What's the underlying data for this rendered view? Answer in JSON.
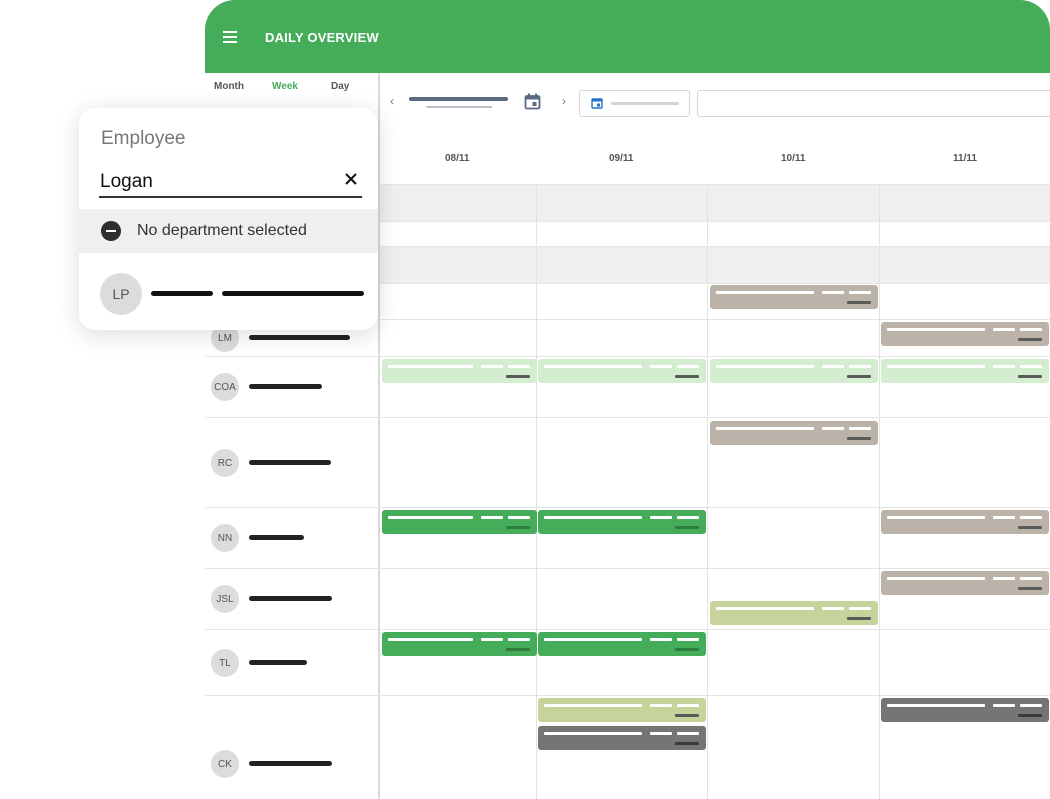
{
  "header": {
    "title": "DAILY OVERVIEW",
    "menu_icon": "menu-icon"
  },
  "views": [
    "Month",
    "Week",
    "Day"
  ],
  "active_view": "Week",
  "days": [
    "08/11",
    "09/11",
    "10/11",
    "11/11"
  ],
  "employees": [
    {
      "initials": "LM"
    },
    {
      "initials": "COA"
    },
    {
      "initials": "RC"
    },
    {
      "initials": "NN"
    },
    {
      "initials": "JSL"
    },
    {
      "initials": "TL"
    },
    {
      "initials": "CK"
    }
  ],
  "panel": {
    "label": "Employee",
    "search_value": "Logan",
    "department_text": "No department selected",
    "result_initials": "LP"
  },
  "colors": {
    "brand_green": "#45ac5a",
    "shift_green": "#45ac5a",
    "shift_light_green": "#d4ecd0",
    "shift_olive": "#c6d39a",
    "shift_taupe": "#bbb3aa",
    "shift_dark_gray": "#757575"
  }
}
